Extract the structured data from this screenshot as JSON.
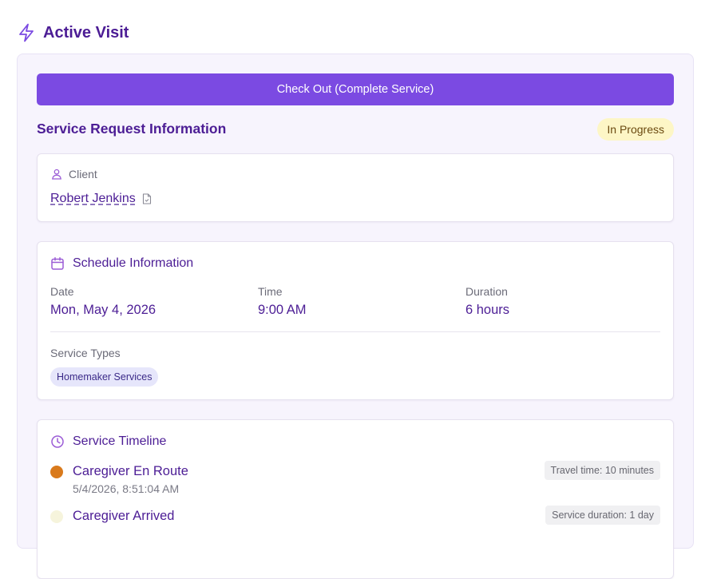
{
  "header": {
    "title": "Active Visit",
    "icon": "lightning-bolt-icon"
  },
  "actions": {
    "checkout_label": "Check Out (Complete Service)"
  },
  "request": {
    "section_title": "Service Request Information",
    "status": "In Progress"
  },
  "client": {
    "label": "Client",
    "name": "Robert Jenkins"
  },
  "schedule": {
    "heading": "Schedule Information",
    "date_label": "Date",
    "date_value": "Mon, May 4, 2026",
    "time_label": "Time",
    "time_value": "9:00 AM",
    "duration_label": "Duration",
    "duration_value": "6 hours",
    "service_types_label": "Service Types",
    "service_types": [
      "Homemaker Services"
    ]
  },
  "timeline": {
    "heading": "Service Timeline",
    "events": [
      {
        "title": "Caregiver En Route",
        "time": "5/4/2026, 8:51:04 AM",
        "tag": "Travel time: 10 minutes",
        "dot_color": "#d97a1c"
      },
      {
        "title": "Caregiver Arrived",
        "time": "",
        "tag": "Service duration: 1 day",
        "dot_color": "#f6f4dc"
      }
    ]
  },
  "colors": {
    "accent": "#7b4ae2",
    "heading": "#4c1d95",
    "status_badge_bg": "#fdf6c6",
    "panel_bg": "#f7f4fd"
  }
}
